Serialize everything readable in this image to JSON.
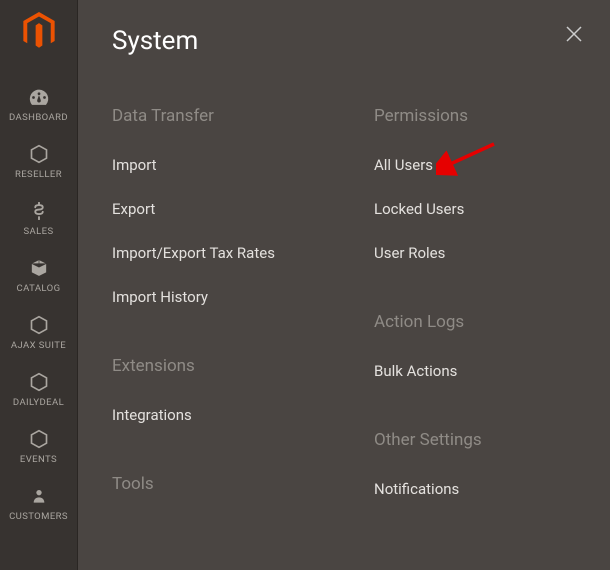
{
  "sidebar": {
    "items": [
      {
        "label": "DASHBOARD"
      },
      {
        "label": "RESELLER"
      },
      {
        "label": "SALES"
      },
      {
        "label": "CATALOG"
      },
      {
        "label": "AJAX SUITE"
      },
      {
        "label": "DAILYDEAL"
      },
      {
        "label": "EVENTS"
      },
      {
        "label": "CUSTOMERS"
      }
    ]
  },
  "panel": {
    "title": "System",
    "columns": [
      {
        "sections": [
          {
            "heading": "Data Transfer",
            "links": [
              "Import",
              "Export",
              "Import/Export Tax Rates",
              "Import History"
            ]
          },
          {
            "heading": "Extensions",
            "links": [
              "Integrations"
            ]
          },
          {
            "heading": "Tools",
            "links": []
          }
        ]
      },
      {
        "sections": [
          {
            "heading": "Permissions",
            "links": [
              "All Users",
              "Locked Users",
              "User Roles"
            ]
          },
          {
            "heading": "Action Logs",
            "links": [
              "Bulk Actions"
            ]
          },
          {
            "heading": "Other Settings",
            "links": [
              "Notifications"
            ]
          }
        ]
      }
    ]
  },
  "annotation": {
    "arrow_target": "All Users",
    "arrow_color": "#e60000"
  }
}
